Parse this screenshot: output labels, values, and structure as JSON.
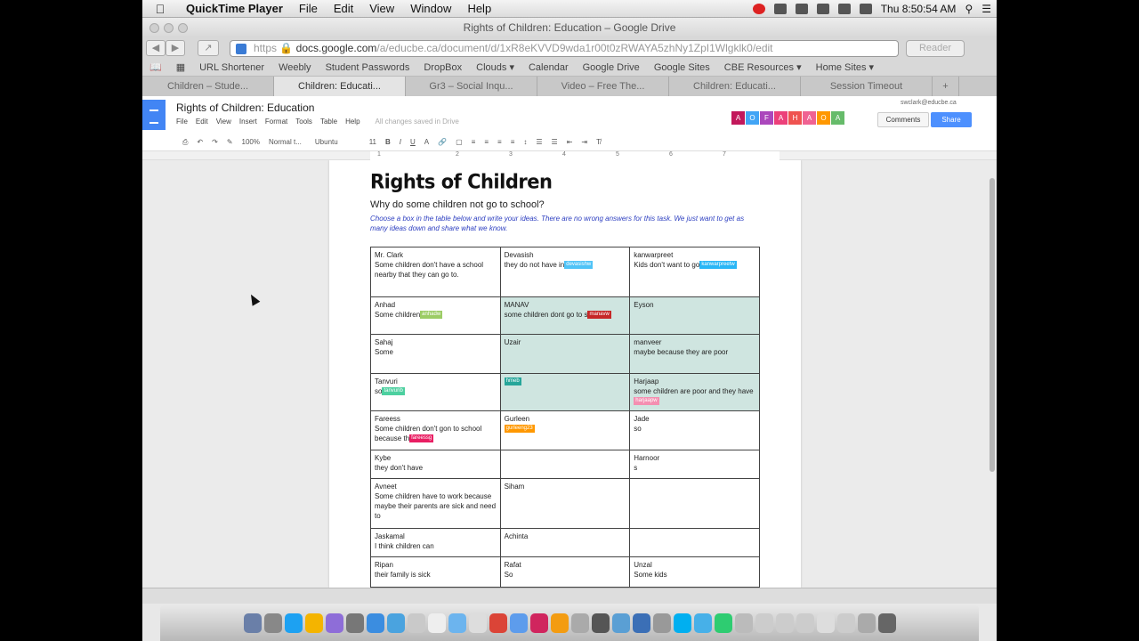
{
  "menubar": {
    "app": "QuickTime Player",
    "items": [
      "File",
      "Edit",
      "View",
      "Window",
      "Help"
    ],
    "clock": "Thu 8:50:54 AM"
  },
  "browser": {
    "window_title": "Rights of Children: Education – Google Drive",
    "url_scheme": "https",
    "url_host": "docs.google.com",
    "url_path": "/a/educbe.ca/document/d/1xR8eKVVD9wda1r00t0zRWAYA5zhNy1ZpI1Wlgklk0/edit",
    "reader": "Reader",
    "bookmarks": [
      "URL Shortener",
      "Weebly",
      "Student Passwords",
      "DropBox",
      "Clouds ▾",
      "Calendar",
      "Google Drive",
      "Google Sites",
      "CBE Resources ▾",
      "Home Sites ▾"
    ],
    "tabs": [
      "Children – Stude...",
      "Children: Educati...",
      "Gr3 – Social Inqu...",
      "Video – Free The...",
      "Children: Educati...",
      "Session Timeout"
    ]
  },
  "docs": {
    "title": "Rights of Children: Education",
    "menus": [
      "File",
      "Edit",
      "View",
      "Insert",
      "Format",
      "Tools",
      "Table",
      "Help"
    ],
    "saved": "All changes saved in Drive",
    "email": "swclark@educbe.ca",
    "comments": "Comments",
    "share": "Share",
    "collaborators": [
      {
        "l": "A",
        "c": "#c2185b"
      },
      {
        "l": "O",
        "c": "#42a5f5"
      },
      {
        "l": "F",
        "c": "#ab47bc"
      },
      {
        "l": "A",
        "c": "#ec407a"
      },
      {
        "l": "H",
        "c": "#ef5350"
      },
      {
        "l": "A",
        "c": "#f06292"
      },
      {
        "l": "O",
        "c": "#ff9800"
      },
      {
        "l": "A",
        "c": "#66bb6a"
      }
    ],
    "toolbar": {
      "zoom": "100%",
      "style": "Normal t...",
      "font": "Ubuntu",
      "size": "11"
    },
    "ruler": [
      "1",
      "2",
      "3",
      "4",
      "5",
      "6",
      "7"
    ]
  },
  "document": {
    "heading": "Rights of Children",
    "question": "Why do some children not go to school?",
    "instructions": "Choose a box in the table below and write your ideas. There are no wrong answers for this task. We just want to get as many ideas down and share what we know."
  },
  "table": [
    [
      {
        "name": "Mr. Clark",
        "text": "Some children don't have a school nearby that they can go to."
      },
      {
        "name": "Devasish",
        "text": "they do not have in",
        "tag": "devasishw",
        "tagColor": "#4fc3f7"
      },
      {
        "name": "kanwarpreet",
        "text": "Kids don't want to go",
        "tag": "kanwarpreetw",
        "tagColor": "#29b6f6"
      }
    ],
    [
      {
        "name": "Anhad",
        "text": "Some children",
        "tag": "anhadw",
        "tagColor": "#9ccc65"
      },
      {
        "name": "MANAV",
        "text": "some children dont go to s",
        "tag": "manavw",
        "tagColor": "#c62828",
        "hl": true
      },
      {
        "name": "Eyson",
        "text": "",
        "hl": true
      }
    ],
    [
      {
        "name": "Sahaj",
        "text": "Some"
      },
      {
        "name": "Uzair",
        "text": "",
        "hl": true
      },
      {
        "name": "manveer",
        "text": "maybe because they are poor",
        "hl": true
      }
    ],
    [
      {
        "name": "Tanvuri",
        "text": "so",
        "tag": "tanvurib",
        "tagColor": "#4dd0a0"
      },
      {
        "name": "",
        "text": "",
        "tag": "hmeb",
        "tagColor": "#26a69a",
        "hl": true
      },
      {
        "name": "Harjaap",
        "text": "some children are poor and they have",
        "tag": "harjaapw",
        "tagColor": "#f48fb1",
        "hl": true
      }
    ],
    [
      {
        "name": "Fareess",
        "text": "Some children don't gon to school because th",
        "tag": "fareessg",
        "tagColor": "#e91e63"
      },
      {
        "name": "Gurleen",
        "text": "",
        "tag": "gurleeng23",
        "tagColor": "#ff9800"
      },
      {
        "name": "Jade",
        "text": "so"
      }
    ],
    [
      {
        "name": "Kybe",
        "text": "they don't have"
      },
      {
        "name": "",
        "text": ""
      },
      {
        "name": "Harnoor",
        "text": "s"
      }
    ],
    [
      {
        "name": "Avneet",
        "text": "Some children have to work because maybe their parents are sick and need to"
      },
      {
        "name": "Siham",
        "text": ""
      },
      {
        "name": "",
        "text": ""
      }
    ],
    [
      {
        "name": "Jaskamal",
        "text": "I think children can"
      },
      {
        "name": "Achinta",
        "text": ""
      },
      {
        "name": "",
        "text": ""
      }
    ],
    [
      {
        "name": "Ripan",
        "text": "their family is sick"
      },
      {
        "name": "Rafat",
        "text": "So"
      },
      {
        "name": "Unzal",
        "text": "Some kids"
      }
    ]
  ]
}
